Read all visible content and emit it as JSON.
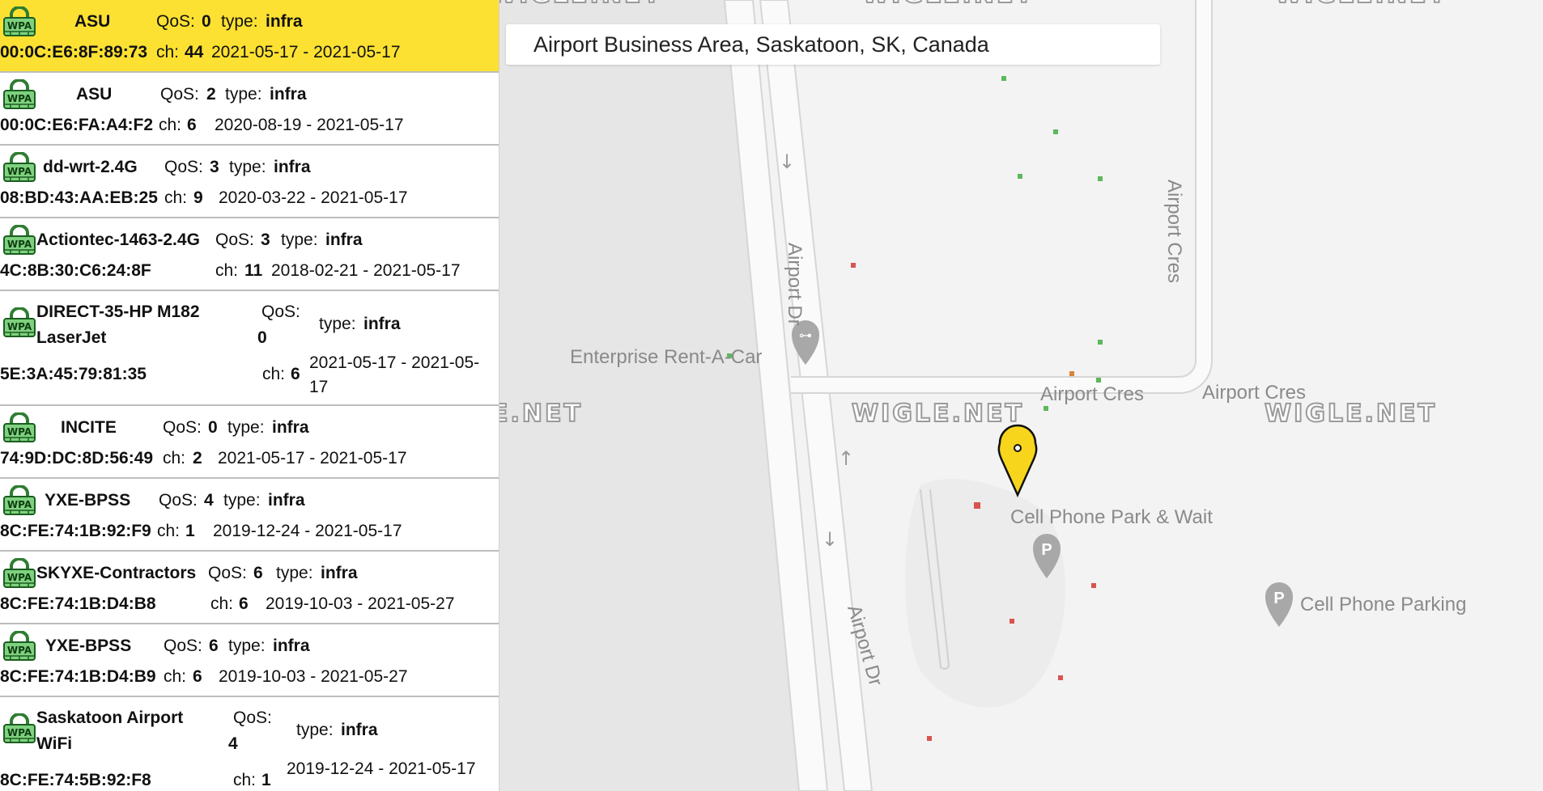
{
  "networks": [
    {
      "ssid": "ASU",
      "qos_label": "QoS:",
      "qos": "0",
      "type_label": "type:",
      "type": "infra",
      "mac": "00:0C:E6:8F:89:73",
      "ch_label": "ch:",
      "ch": "44",
      "dates": "2021-05-17 - 2021-05-17",
      "selected": true
    },
    {
      "ssid": "ASU",
      "qos_label": "QoS:",
      "qos": "2",
      "type_label": "type:",
      "type": "infra",
      "mac": "00:0C:E6:FA:A4:F2",
      "ch_label": "ch:",
      "ch": "6",
      "dates": "2020-08-19 - 2021-05-17"
    },
    {
      "ssid": "dd-wrt-2.4G",
      "qos_label": "QoS:",
      "qos": "3",
      "type_label": "type:",
      "type": "infra",
      "mac": "08:BD:43:AA:EB:25",
      "ch_label": "ch:",
      "ch": "9",
      "dates": "2020-03-22 - 2021-05-17"
    },
    {
      "ssid": "Actiontec-1463-2.4G",
      "qos_label": "QoS:",
      "qos": "3",
      "type_label": "type:",
      "type": "infra",
      "mac": "4C:8B:30:C6:24:8F",
      "ch_label": "ch:",
      "ch": "11",
      "dates": "2018-02-21 - 2021-05-17"
    },
    {
      "ssid": "DIRECT-35-HP M182 LaserJet",
      "qos_label": "QoS:",
      "qos": "0",
      "type_label": "type:",
      "type": "infra",
      "mac": "5E:3A:45:79:81:35",
      "ch_label": "ch:",
      "ch": "6",
      "dates": "2021-05-17 - 2021-05-17"
    },
    {
      "ssid": "INCITE",
      "qos_label": "QoS:",
      "qos": "0",
      "type_label": "type:",
      "type": "infra",
      "mac": "74:9D:DC:8D:56:49",
      "ch_label": "ch:",
      "ch": "2",
      "dates": "2021-05-17 - 2021-05-17"
    },
    {
      "ssid": "YXE-BPSS",
      "qos_label": "QoS:",
      "qos": "4",
      "type_label": "type:",
      "type": "infra",
      "mac": "8C:FE:74:1B:92:F9",
      "ch_label": "ch:",
      "ch": "1",
      "dates": "2019-12-24 - 2021-05-17"
    },
    {
      "ssid": "SKYXE-Contractors",
      "qos_label": "QoS:",
      "qos": "6",
      "type_label": "type:",
      "type": "infra",
      "mac": "8C:FE:74:1B:D4:B8",
      "ch_label": "ch:",
      "ch": "6",
      "dates": "2019-10-03 - 2021-05-27"
    },
    {
      "ssid": "YXE-BPSS",
      "qos_label": "QoS:",
      "qos": "6",
      "type_label": "type:",
      "type": "infra",
      "mac": "8C:FE:74:1B:D4:B9",
      "ch_label": "ch:",
      "ch": "6",
      "dates": "2019-10-03 - 2021-05-27"
    },
    {
      "ssid": "Saskatoon Airport WiFi",
      "qos_label": "QoS:",
      "qos": "4",
      "type_label": "type:",
      "type": "infra",
      "mac": "8C:FE:74:5B:92:F8",
      "ch_label": "ch:",
      "ch": "1",
      "dates": "2019-12-24 - 2021-05-17"
    }
  ],
  "security_icon": {
    "name": "wpa-lock-icon",
    "text": "WPA"
  },
  "map": {
    "search_value": "Airport Business Area, Saskatoon, SK, Canada",
    "watermark": "WIGLE.NET",
    "labels": {
      "airport_dr": "Airport Dr",
      "airport_cres": "Airport Cres",
      "enterprise": "Enterprise Rent-A-Car",
      "cell_park_wait": "Cell Phone Park & Wait",
      "cell_parking": "Cell Phone Parking",
      "parking_glyph": "P"
    },
    "colors": {
      "pin": "#f7d51d",
      "green_dot": "#5cb85c",
      "red_dot": "#d9534f",
      "orange_dot": "#d9843b"
    }
  }
}
